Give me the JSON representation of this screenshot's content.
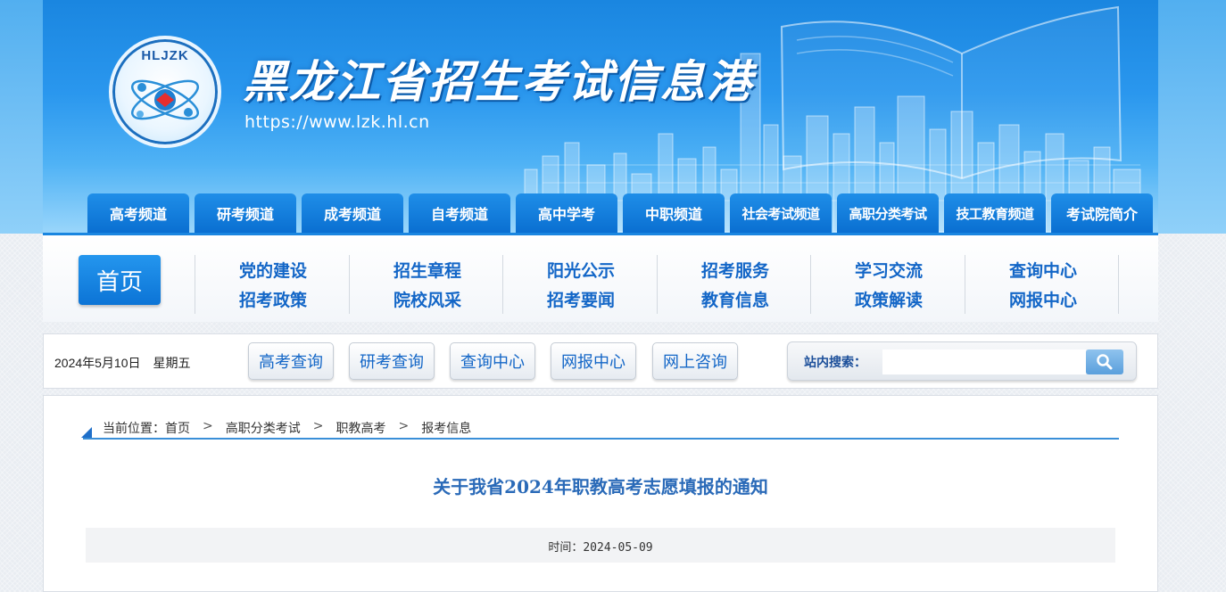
{
  "header": {
    "logo_text": "HLJZK",
    "site_title": "黑龙江省招生考试信息港",
    "site_url": "https://www.lzk.hl.cn"
  },
  "channel_tabs": [
    "高考频道",
    "研考频道",
    "成考频道",
    "自考频道",
    "高中学考",
    "中职频道",
    "社会考试频道",
    "高职分类考试",
    "技工教育频道",
    "考试院简介"
  ],
  "nav": {
    "home_label": "首页",
    "columns": [
      [
        "党的建设",
        "招考政策"
      ],
      [
        "招生章程",
        "院校风采"
      ],
      [
        "阳光公示",
        "招考要闻"
      ],
      [
        "招考服务",
        "教育信息"
      ],
      [
        "学习交流",
        "政策解读"
      ],
      [
        "查询中心",
        "网报中心"
      ]
    ]
  },
  "quickbar": {
    "date": "2024年5月10日　星期五",
    "buttons": [
      "高考查询",
      "研考查询",
      "查询中心",
      "网报中心",
      "网上咨询"
    ],
    "search_label": "站内搜索：",
    "search_value": "",
    "search_icon": "search-icon"
  },
  "breadcrumb": {
    "prefix": "当前位置：",
    "items": [
      "首页",
      "高职分类考试",
      "职教高考",
      "报考信息"
    ],
    "separator": ">"
  },
  "article": {
    "title": "关于我省2024年职教高考志愿填报的通知",
    "time": "时间：2024-05-09"
  },
  "colors": {
    "brand_blue": "#0a6fd1",
    "nav_text": "#1366c7",
    "title_text": "#2a6ab8"
  }
}
